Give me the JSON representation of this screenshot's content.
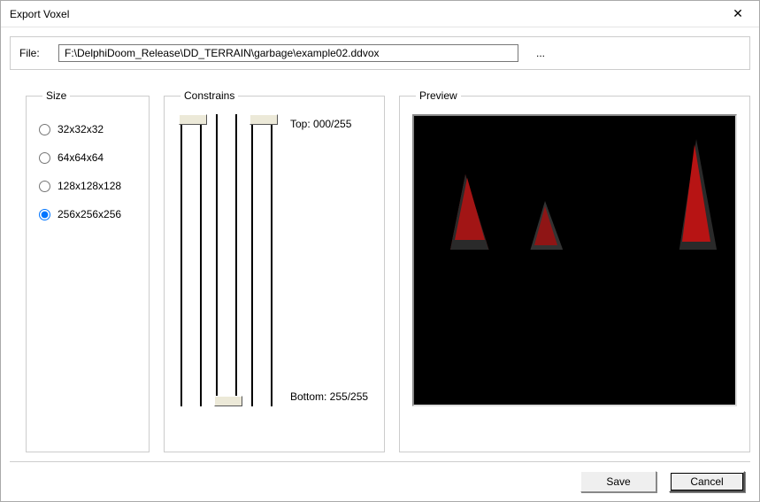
{
  "window": {
    "title": "Export Voxel"
  },
  "file": {
    "label": "File:",
    "value": "F:\\DelphiDoom_Release\\DD_TERRAIN\\garbage\\example02.ddvox",
    "browse": "..."
  },
  "size": {
    "legend": "Size",
    "options": [
      {
        "label": "32x32x32",
        "checked": false
      },
      {
        "label": "64x64x64",
        "checked": false
      },
      {
        "label": "128x128x128",
        "checked": false
      },
      {
        "label": "256x256x256",
        "checked": true
      }
    ]
  },
  "constrains": {
    "legend": "Constrains",
    "top_label": "Top: 000/255",
    "bottom_label": "Bottom: 255/255"
  },
  "preview": {
    "legend": "Preview"
  },
  "buttons": {
    "save": "Save",
    "cancel": "Cancel"
  }
}
